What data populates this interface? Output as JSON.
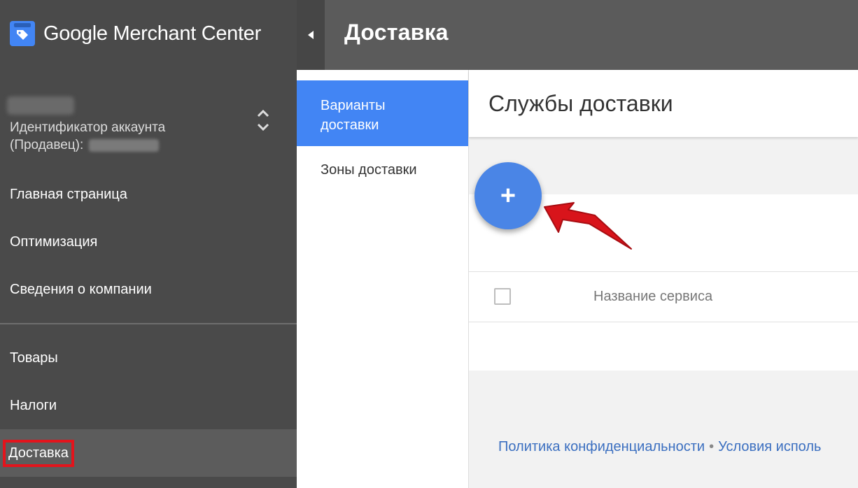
{
  "app": {
    "brand": "Google Merchant Center"
  },
  "account": {
    "id_label": "Идентификатор аккаунта",
    "role_label": "(Продавец):"
  },
  "sidebar": {
    "items": [
      {
        "label": "Главная страница"
      },
      {
        "label": "Оптимизация"
      },
      {
        "label": "Сведения о компании"
      },
      {
        "label": "Товары"
      },
      {
        "label": "Налоги"
      },
      {
        "label": "Доставка"
      }
    ]
  },
  "header": {
    "title": "Доставка"
  },
  "subnav": {
    "items": [
      {
        "label_line1": "Варианты",
        "label_line2": "доставки"
      },
      {
        "label": "Зоны доставки"
      }
    ]
  },
  "main": {
    "title": "Службы доставки",
    "add_button": "+",
    "table": {
      "columns": [
        "Название сервиса"
      ]
    }
  },
  "footer": {
    "privacy": "Политика конфиденциальности",
    "separator": "•",
    "terms": "Условия исполь"
  },
  "colors": {
    "accent": "#4285f4",
    "highlight": "#e3141c",
    "sidebar": "#4a4a4a"
  }
}
